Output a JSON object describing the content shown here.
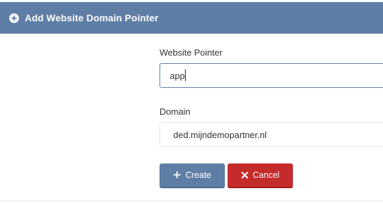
{
  "header": {
    "title": "Add Website Domain Pointer",
    "icon": "plus-circle-icon"
  },
  "form": {
    "pointer": {
      "label": "Website Pointer",
      "value": "app"
    },
    "domain": {
      "label": "Domain",
      "value": "ded.mijndemopartner.nl"
    }
  },
  "buttons": {
    "create": {
      "label": "Create",
      "icon": "plus-icon"
    },
    "cancel": {
      "label": "Cancel",
      "icon": "x-icon"
    }
  },
  "colors": {
    "header_bg": "#5f7ea6",
    "primary": "#5f7ea6",
    "danger": "#c42b2b"
  }
}
